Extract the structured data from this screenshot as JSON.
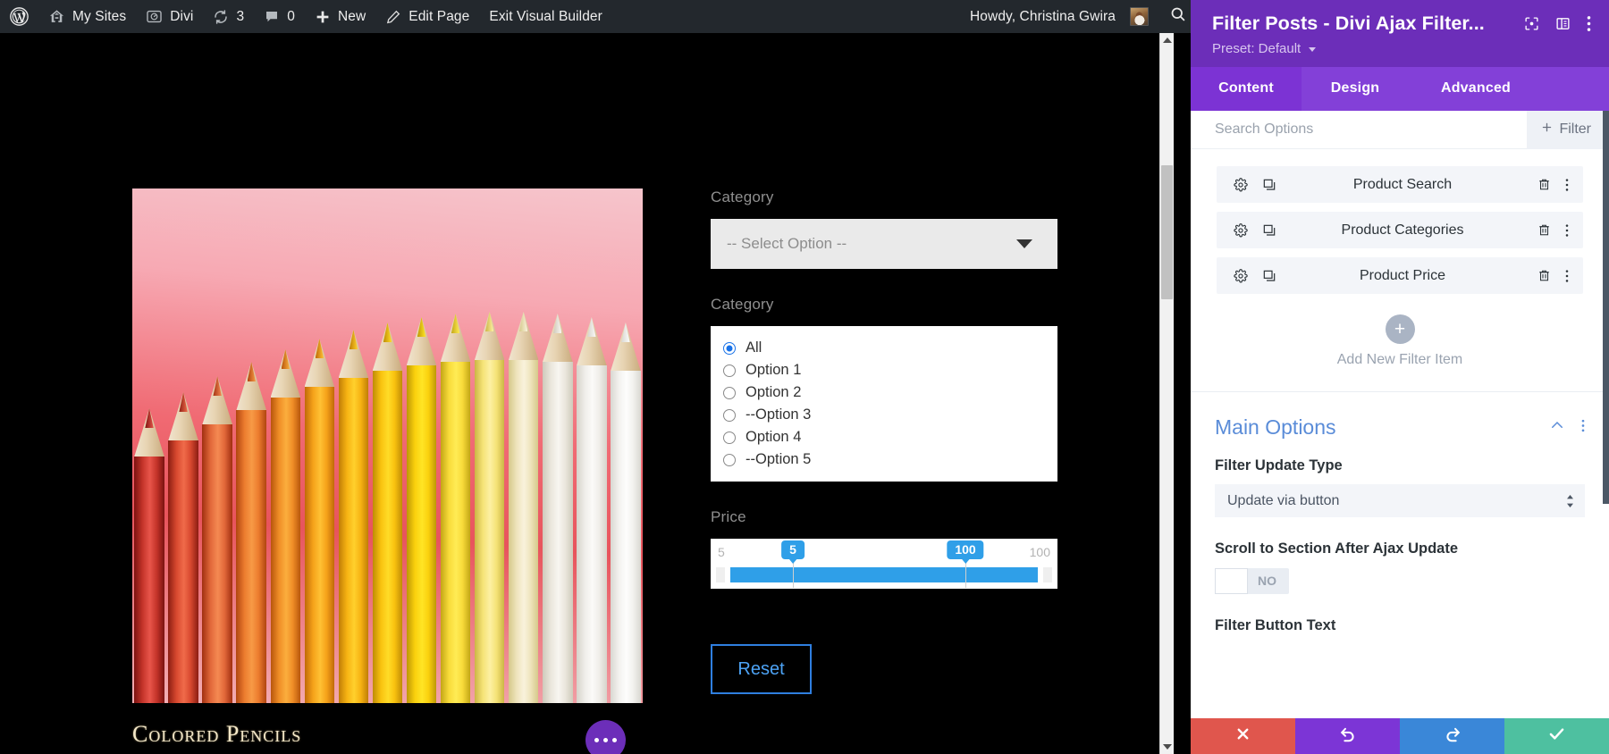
{
  "adminbar": {
    "items": [
      {
        "icon": "wordpress-logo-icon",
        "label": ""
      },
      {
        "icon": "my-sites-icon",
        "label": "My Sites"
      },
      {
        "icon": "divi-gauge-icon",
        "label": "Divi"
      },
      {
        "icon": "updates-icon",
        "label": "3"
      },
      {
        "icon": "comments-icon",
        "label": "0"
      },
      {
        "icon": "plus-icon",
        "label": "New"
      },
      {
        "icon": "pencil-icon",
        "label": "Edit Page"
      },
      {
        "icon": "",
        "label": "Exit Visual Builder"
      }
    ],
    "howdy": "Howdy, Christina Gwira",
    "search_icon": "search-icon"
  },
  "canvas": {
    "image_caption": "Colored Pencils",
    "fab_label": "module-settings-dots",
    "filters": [
      {
        "label": "Category",
        "type": "select",
        "value": "-- Select Option --"
      },
      {
        "label": "Category",
        "type": "radio",
        "options": [
          {
            "label": "All",
            "selected": true
          },
          {
            "label": "Option 1",
            "selected": false
          },
          {
            "label": "Option 2",
            "selected": false
          },
          {
            "label": "--Option 3",
            "selected": false
          },
          {
            "label": "Option 4",
            "selected": false
          },
          {
            "label": "--Option 5",
            "selected": false
          }
        ]
      },
      {
        "label": "Price",
        "type": "range",
        "range_min_label": "5",
        "range_max_label": "100",
        "handle_low": "5",
        "handle_high": "100"
      }
    ],
    "reset_label": "Reset"
  },
  "panel": {
    "title": "Filter Posts - Divi Ajax Filter...",
    "preset": "Preset: Default",
    "header_icons": [
      "focus-module-icon",
      "layout-panel-icon",
      "kebab-menu-icon"
    ],
    "tabs": [
      {
        "label": "Content",
        "active": true
      },
      {
        "label": "Design",
        "active": false
      },
      {
        "label": "Advanced",
        "active": false
      }
    ],
    "search_placeholder": "Search Options",
    "add_filter_label": "Filter",
    "filter_items": [
      {
        "name": "Product Search"
      },
      {
        "name": "Product Categories"
      },
      {
        "name": "Product Price"
      }
    ],
    "add_new_label": "Add New Filter Item",
    "section": {
      "title": "Main Options",
      "fields": [
        {
          "label": "Filter Update Type",
          "type": "select",
          "value": "Update via button"
        },
        {
          "label": "Scroll to Section After Ajax Update",
          "type": "toggle",
          "value": "NO"
        },
        {
          "label": "Filter Button Text",
          "type": "text"
        }
      ]
    },
    "footer_buttons": [
      {
        "name": "cancel",
        "icon": "close-icon"
      },
      {
        "name": "undo",
        "icon": "undo-icon"
      },
      {
        "name": "redo",
        "icon": "redo-icon"
      },
      {
        "name": "save",
        "icon": "check-icon"
      }
    ]
  },
  "colors": {
    "panel_purple": "#6c2eb9",
    "tab_purple": "#8340d8",
    "accent_blue": "#2f9fe8",
    "section_title_blue": "#5a8cd8",
    "save_green": "#4ec0a0",
    "cancel_red": "#e0564d"
  }
}
